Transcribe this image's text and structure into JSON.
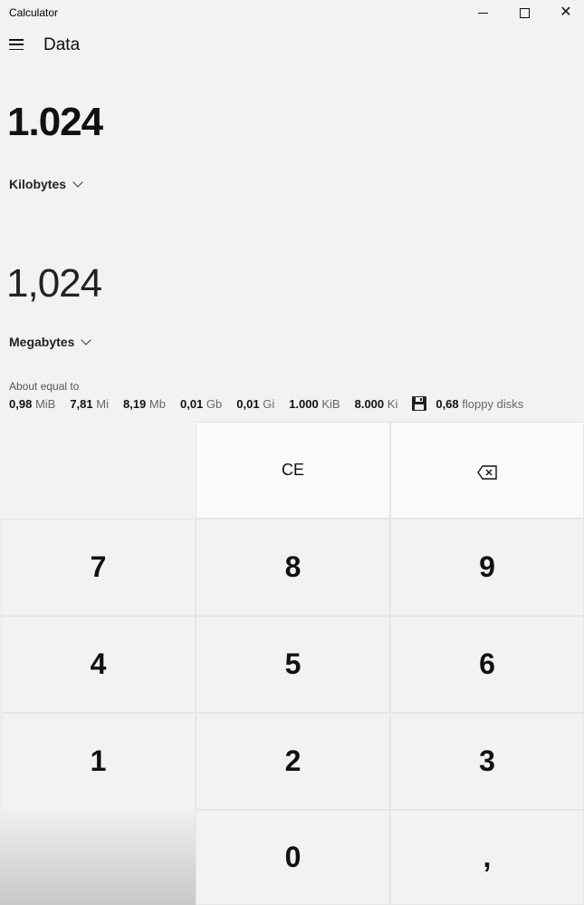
{
  "window": {
    "title": "Calculator",
    "minimize_label": "—",
    "close_label": "✕"
  },
  "header": {
    "mode_title": "Data"
  },
  "converter": {
    "from_value": "1.024",
    "from_unit": "Kilobytes",
    "to_value": "1,024",
    "to_unit": "Megabytes"
  },
  "about": {
    "label": "About equal to",
    "items": [
      {
        "value": "0,98",
        "unit": "MiB"
      },
      {
        "value": "7,81",
        "unit": "Mi"
      },
      {
        "value": "8,19",
        "unit": "Mb"
      },
      {
        "value": "0,01",
        "unit": "Gb"
      },
      {
        "value": "0,01",
        "unit": "Gi"
      },
      {
        "value": "1.000",
        "unit": "KiB"
      },
      {
        "value": "8.000",
        "unit": "Ki"
      },
      {
        "value": "0,68",
        "unit": "floppy disks",
        "icon": "floppy-disk-icon"
      }
    ]
  },
  "keypad": {
    "ce": "CE",
    "backspace_icon": "backspace-icon",
    "k7": "7",
    "k8": "8",
    "k9": "9",
    "k4": "4",
    "k5": "5",
    "k6": "6",
    "k1": "1",
    "k2": "2",
    "k3": "3",
    "k0": "0",
    "decimal": ","
  }
}
